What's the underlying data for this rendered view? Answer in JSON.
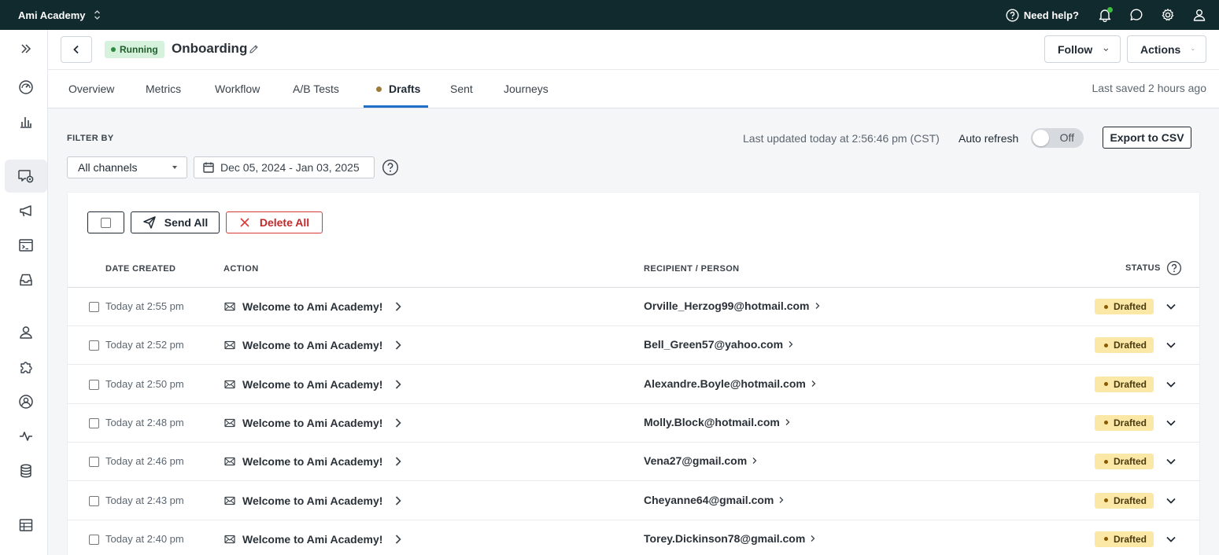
{
  "topbar": {
    "workspace": "Ami Academy",
    "help_label": "Need help?"
  },
  "sidebar": {
    "icons": [
      "expand-sidebar-icon",
      "dashboard-icon",
      "analytics-icon",
      "messages-icon",
      "broadcast-icon",
      "terminal-icon",
      "inbox-icon",
      "people-icon",
      "integrations-icon",
      "account-icon",
      "activity-icon",
      "data-icon",
      "table-icon"
    ],
    "active": "messages-icon"
  },
  "header": {
    "status": "Running",
    "title": "Onboarding",
    "follow_label": "Follow",
    "actions_label": "Actions"
  },
  "tabs": {
    "items": [
      {
        "label": "Overview"
      },
      {
        "label": "Metrics"
      },
      {
        "label": "Workflow"
      },
      {
        "label": "A/B Tests"
      },
      {
        "label": "Drafts"
      },
      {
        "label": "Sent"
      },
      {
        "label": "Journeys"
      }
    ],
    "active": "Drafts",
    "last_saved": "Last saved 2 hours ago"
  },
  "filters": {
    "label": "FILTER BY",
    "channel": "All channels",
    "date_range": "Dec 05, 2024 - Jan 03, 2025",
    "last_updated": "Last updated today at 2:56:46 pm (CST)",
    "auto_refresh_label": "Auto refresh",
    "auto_refresh_state": "Off",
    "export_label": "Export to CSV"
  },
  "bulk": {
    "send_all": "Send All",
    "delete_all": "Delete All"
  },
  "table": {
    "columns": {
      "date": "DATE CREATED",
      "action": "ACTION",
      "recipient": "RECIPIENT / PERSON",
      "status": "STATUS"
    },
    "rows": [
      {
        "date": "Today at 2:55 pm",
        "action": "Welcome to Ami Academy!",
        "recipient": "Orville_Herzog99@hotmail.com",
        "status": "Drafted"
      },
      {
        "date": "Today at 2:52 pm",
        "action": "Welcome to Ami Academy!",
        "recipient": "Bell_Green57@yahoo.com",
        "status": "Drafted"
      },
      {
        "date": "Today at 2:50 pm",
        "action": "Welcome to Ami Academy!",
        "recipient": "Alexandre.Boyle@hotmail.com",
        "status": "Drafted"
      },
      {
        "date": "Today at 2:48 pm",
        "action": "Welcome to Ami Academy!",
        "recipient": "Molly.Block@hotmail.com",
        "status": "Drafted"
      },
      {
        "date": "Today at 2:46 pm",
        "action": "Welcome to Ami Academy!",
        "recipient": "Vena27@gmail.com",
        "status": "Drafted"
      },
      {
        "date": "Today at 2:43 pm",
        "action": "Welcome to Ami Academy!",
        "recipient": "Cheyanne64@gmail.com",
        "status": "Drafted"
      },
      {
        "date": "Today at 2:40 pm",
        "action": "Welcome to Ami Academy!",
        "recipient": "Torey.Dickinson78@gmail.com",
        "status": "Drafted"
      }
    ]
  },
  "colors": {
    "topbar": "#102a2d",
    "accent": "#1f6fc9",
    "running_bg": "#d7f2dc",
    "drafted_bg": "#fbe8a6",
    "danger": "#c62828"
  }
}
